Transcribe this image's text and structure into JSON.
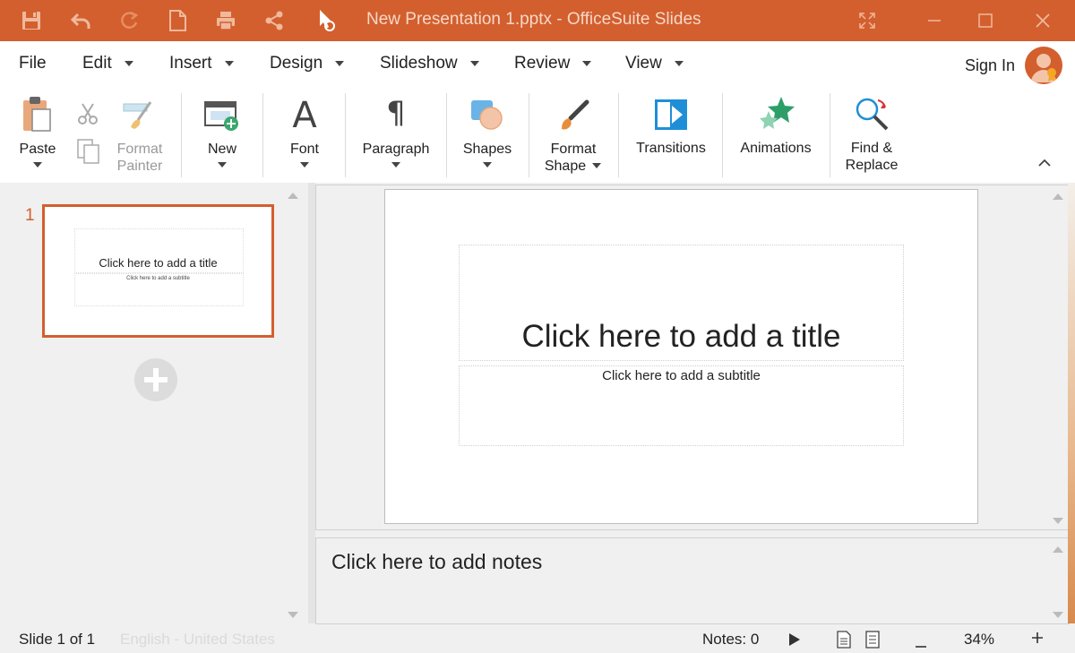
{
  "window": {
    "title": "New Presentation 1.pptx - OfficeSuite Slides",
    "accent": "#d35f2e"
  },
  "quick_access": [
    "save-icon",
    "undo-icon",
    "redo-icon",
    "new-document-icon",
    "print-icon",
    "share-icon",
    "cursor-reload-icon"
  ],
  "menu": {
    "items": [
      {
        "label": "File",
        "has_caret": false
      },
      {
        "label": "Edit",
        "has_caret": true
      },
      {
        "label": "Insert",
        "has_caret": true
      },
      {
        "label": "Design",
        "has_caret": true
      },
      {
        "label": "Slideshow",
        "has_caret": true
      },
      {
        "label": "Review",
        "has_caret": true
      },
      {
        "label": "View",
        "has_caret": true
      }
    ],
    "sign_in": "Sign In"
  },
  "ribbon": {
    "paste": "Paste",
    "format_painter_1": "Format",
    "format_painter_2": "Painter",
    "new": "New",
    "font": "Font",
    "paragraph": "Paragraph",
    "shapes": "Shapes",
    "format_shape_1": "Format",
    "format_shape_2": "Shape",
    "transitions": "Transitions",
    "animations": "Animations",
    "find_replace_1": "Find &",
    "find_replace_2": "Replace"
  },
  "thumbnails": {
    "number": "1",
    "title": "Click here to add a title",
    "subtitle": "Click here to add a subtitle"
  },
  "slide": {
    "title_placeholder": "Click here to add a title",
    "subtitle_placeholder": "Click here to add a subtitle"
  },
  "notes": {
    "placeholder": "Click here to add notes"
  },
  "status": {
    "slide": "Slide 1 of 1",
    "language": "English - United States",
    "notes": "Notes: 0",
    "zoom": "34%"
  }
}
